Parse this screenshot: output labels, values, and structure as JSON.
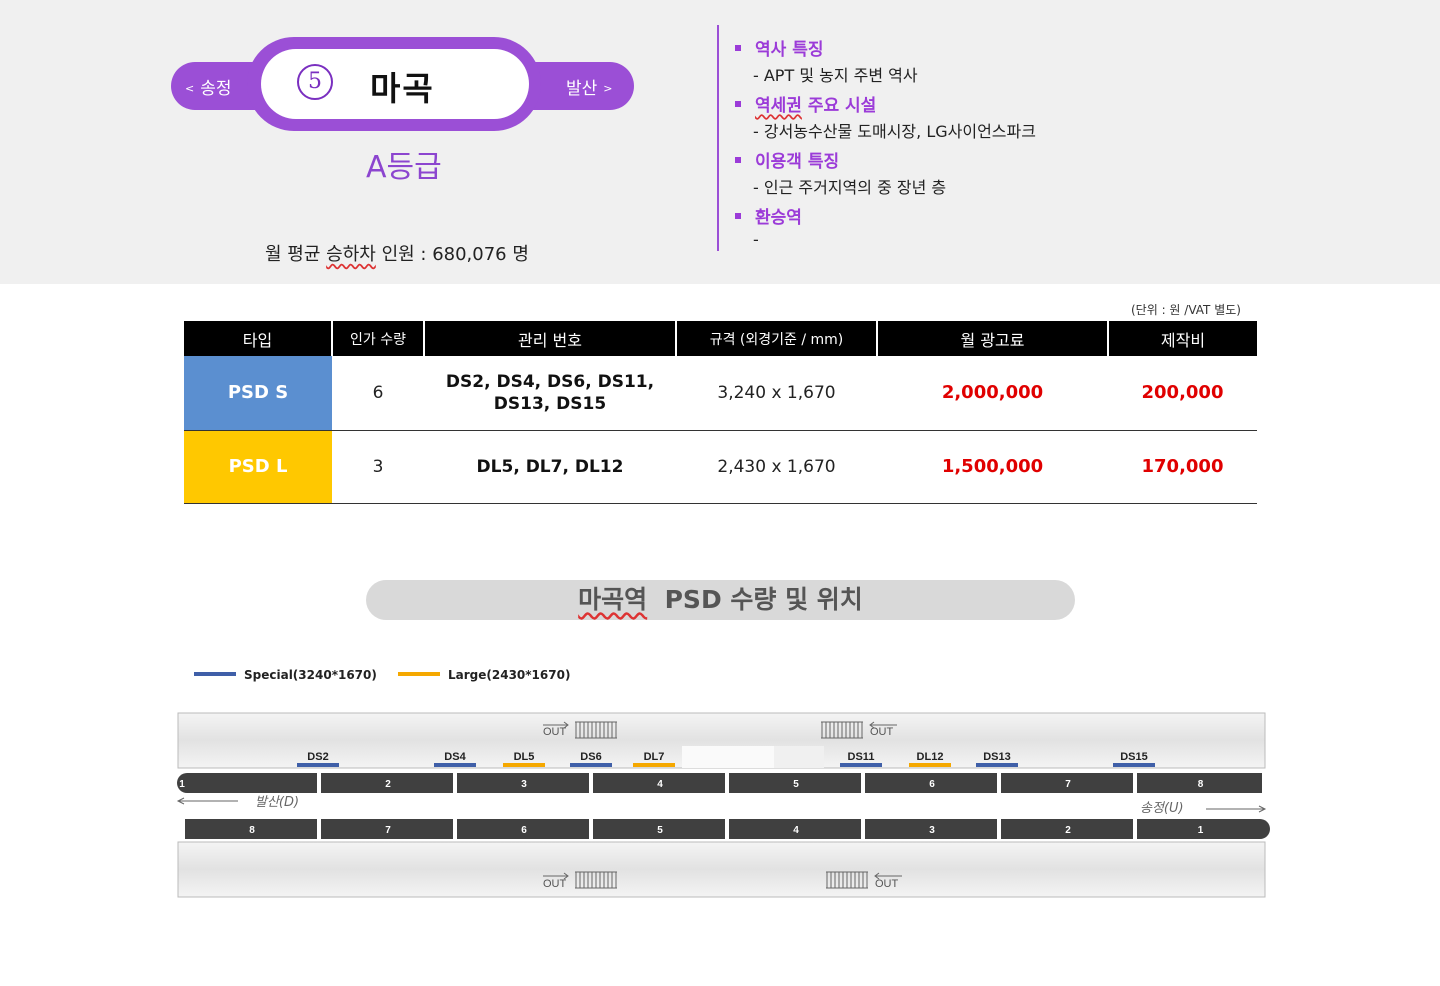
{
  "station": {
    "prev": "송정",
    "next": "발산",
    "number": "5",
    "name": "마곡",
    "grade": "A등급",
    "monthly_label": "월 평균",
    "monthly_wavy": "승하차",
    "monthly_rest": "인원 :  680,076 명"
  },
  "info": [
    {
      "head_pre": "역사 특징",
      "head_wavy": "",
      "head_post": "",
      "sub": "-  APT 및 농지 주변 역사"
    },
    {
      "head_pre": "",
      "head_wavy": "역세권",
      "head_post": " 주요 시설",
      "sub": "-  강서농수산물 도매시장, LG사이언스파크"
    },
    {
      "head_pre": "이용객 특징",
      "head_wavy": "",
      "head_post": "",
      "sub": "-  인근 주거지역의 중 장년 층"
    },
    {
      "head_pre": "환승역",
      "head_wavy": "",
      "head_post": "",
      "sub": "-"
    }
  ],
  "unit_note": "(단위 : 원 /VAT 별도)",
  "table": {
    "headers": [
      "타입",
      "인가 수량",
      "관리 번호",
      "규격 (외경기준 / mm)",
      "월 광고료",
      "제작비"
    ],
    "rows": [
      {
        "type": "PSD S",
        "qty": "6",
        "codes_line1": "DS2, DS4, DS6, DS11,",
        "codes_line2": "DS13, DS15",
        "size": "3,240 x 1,670",
        "monthly": "2,000,000",
        "production": "200,000"
      },
      {
        "type": "PSD L",
        "qty": "3",
        "codes_line1": "DL5, DL7, DL12",
        "codes_line2": "",
        "size": "2,430 x 1,670",
        "monthly": "1,500,000",
        "production": "170,000"
      }
    ]
  },
  "section": {
    "title_wavy": "마곡역",
    "title_rest": "PSD 수량 및 위치"
  },
  "legend": [
    {
      "label": "Special(3240*1670)",
      "color": "#3f5fa8"
    },
    {
      "label": "Large(2430*1670)",
      "color": "#f5a800"
    }
  ],
  "map": {
    "out_label": "OUT",
    "left_direction": "발산(D)",
    "right_direction": "송정(U)",
    "markers": [
      {
        "label": "DS2",
        "kind": "special"
      },
      {
        "label": "DS4",
        "kind": "special"
      },
      {
        "label": "DL5",
        "kind": "large"
      },
      {
        "label": "DS6",
        "kind": "special"
      },
      {
        "label": "DL7",
        "kind": "large"
      },
      {
        "label": "DS11",
        "kind": "special"
      },
      {
        "label": "DL12",
        "kind": "large"
      },
      {
        "label": "DS13",
        "kind": "special"
      },
      {
        "label": "DS15",
        "kind": "special"
      }
    ],
    "upper_cars": [
      "1",
      "2",
      "3",
      "4",
      "5",
      "6",
      "7",
      "8"
    ],
    "lower_cars": [
      "8",
      "7",
      "6",
      "5",
      "4",
      "3",
      "2",
      "1"
    ],
    "colors": {
      "special": "#3f5fa8",
      "large": "#f5a800",
      "car": "#404040"
    }
  }
}
